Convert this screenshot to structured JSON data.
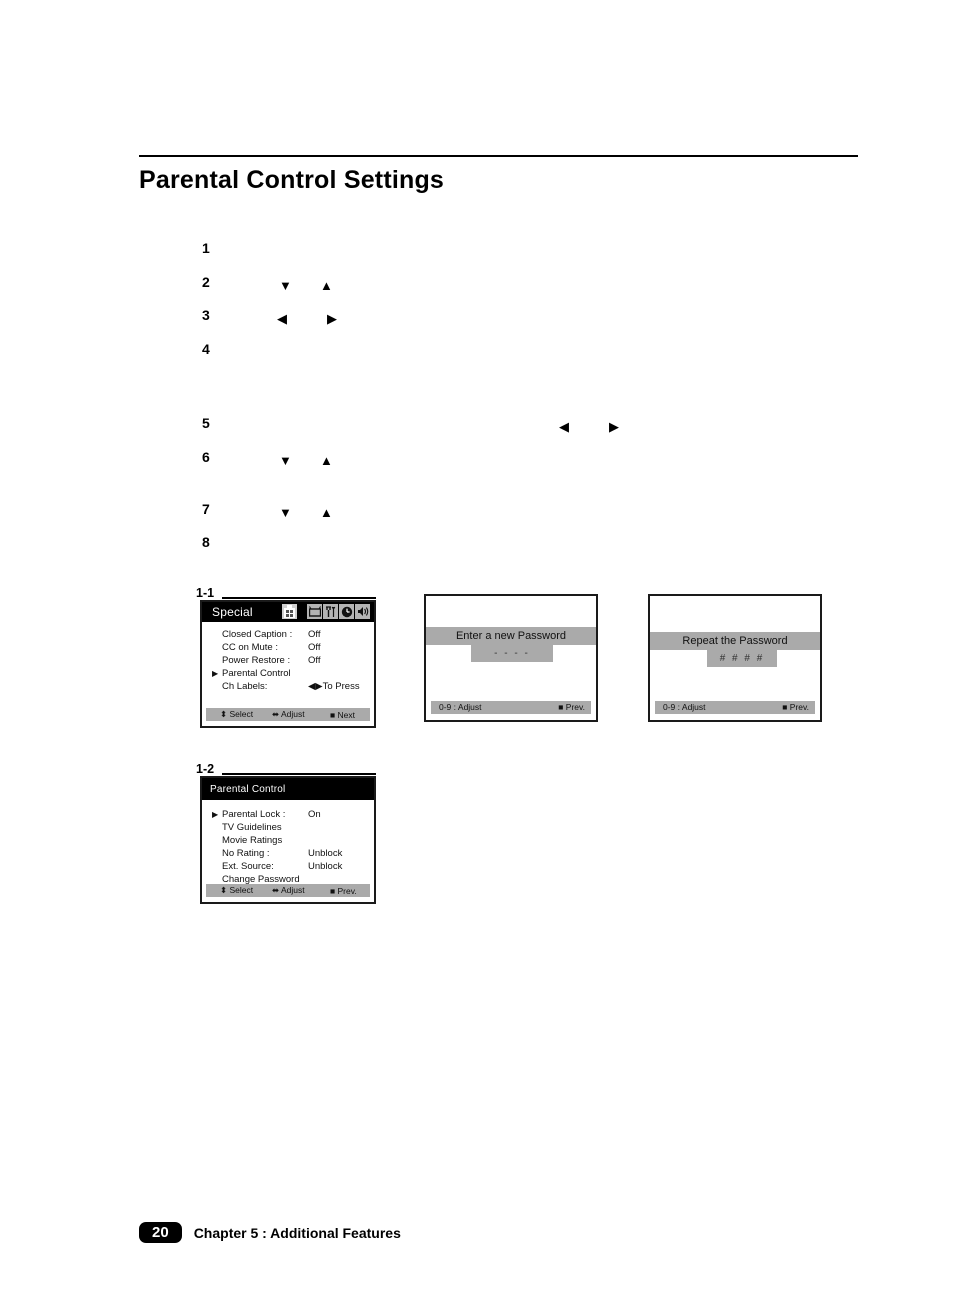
{
  "document": {
    "title": "Parental Control Settings",
    "footer": {
      "page_number": "20",
      "chapter": "Chapter 5 : Additional Features"
    }
  },
  "steps": [
    {
      "number": "1",
      "glyphs": []
    },
    {
      "number": "2",
      "glyphs": [
        "▼",
        "▲"
      ]
    },
    {
      "number": "3",
      "glyphs": [
        "◀",
        "▶"
      ]
    },
    {
      "number": "4",
      "glyphs": []
    },
    {
      "number": "5",
      "glyphs": [
        "◀",
        "▶"
      ]
    },
    {
      "number": "6",
      "glyphs": [
        "▼",
        "▲"
      ]
    },
    {
      "number": "7",
      "glyphs": [
        "▼",
        "▲"
      ]
    },
    {
      "number": "8",
      "glyphs": []
    }
  ],
  "figures": {
    "fig_1_1": {
      "label": "1-1",
      "title": "Special",
      "icons": [
        {
          "name": "special-grid-icon",
          "glyph": "☷",
          "selected": true
        },
        {
          "name": "tv-icon",
          "glyph": "▣"
        },
        {
          "name": "tools-icon",
          "glyph": "⑂"
        },
        {
          "name": "clock-icon",
          "glyph": "◕"
        },
        {
          "name": "speaker-icon",
          "glyph": "◂)"
        }
      ],
      "rows": [
        {
          "label": "Closed Caption :",
          "value": "Off",
          "cursor": false
        },
        {
          "label": "CC on Mute :",
          "value": "Off",
          "cursor": false
        },
        {
          "label": "Power Restore :",
          "value": "Off",
          "cursor": false
        },
        {
          "label": "Parental Control",
          "value": "",
          "cursor": true
        },
        {
          "label": "Ch Labels:",
          "value": "◀▶To Press",
          "cursor": false
        }
      ],
      "footer": {
        "select": "⬍ Select",
        "adjust": "⬌ Adjust",
        "action": "■ Next"
      }
    },
    "fig_1_2": {
      "label": "1-2",
      "title": "Parental Control",
      "rows": [
        {
          "label": "Parental Lock :",
          "value": "On",
          "cursor": true
        },
        {
          "label": "TV Guidelines",
          "value": "",
          "cursor": false
        },
        {
          "label": "Movie Ratings",
          "value": "",
          "cursor": false
        },
        {
          "label": "No Rating :",
          "value": "Unblock",
          "cursor": false
        },
        {
          "label": "Ext. Source:",
          "value": "Unblock",
          "cursor": false
        },
        {
          "label": "Change Password",
          "value": "",
          "cursor": false
        }
      ],
      "footer": {
        "select": "⬍ Select",
        "adjust": "⬌ Adjust",
        "action": "■ Prev."
      }
    },
    "dialog_new_password": {
      "band_text": "Enter a new Password",
      "field_value": "- - - -",
      "footer_left": "0-9 : Adjust",
      "footer_right": "■ Prev."
    },
    "dialog_repeat_password": {
      "band_text": "Repeat the Password",
      "field_value": "# # # #",
      "footer_left": "0-9 : Adjust",
      "footer_right": "■ Prev."
    }
  },
  "colors": {
    "ink": "#000000",
    "osd_gray": "#aaaaaa",
    "osd_icon_gray": "#b4b4b4",
    "paper": "#ffffff"
  }
}
